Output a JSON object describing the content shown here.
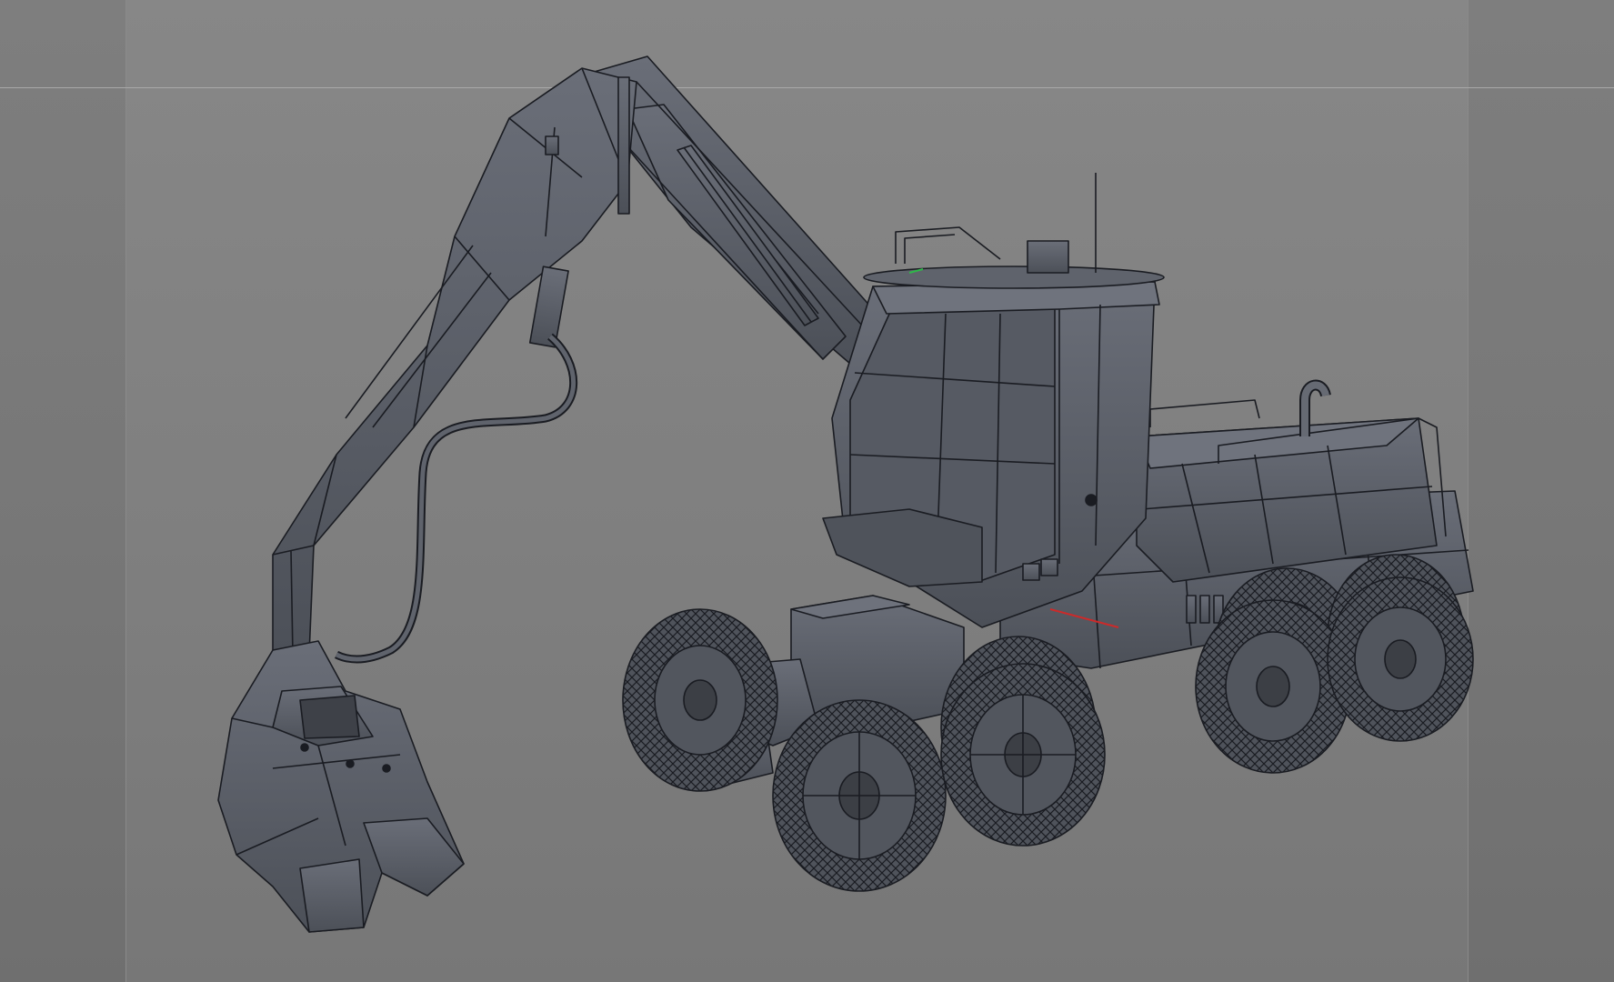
{
  "viewport": {
    "mode": "wireframe-shaded",
    "background_color": "#7f7f7f",
    "safe_frame_color": "#868686",
    "horizon_line_color": "#a8a8a8",
    "model": {
      "subject": "forestry-harvester",
      "body_color": "#5b5f68",
      "edge_color": "#1a1c22",
      "wheel_count": 8
    },
    "axis_gizmo": {
      "x_color": "#cc2a2a",
      "y_color": "#2fb84a"
    }
  }
}
